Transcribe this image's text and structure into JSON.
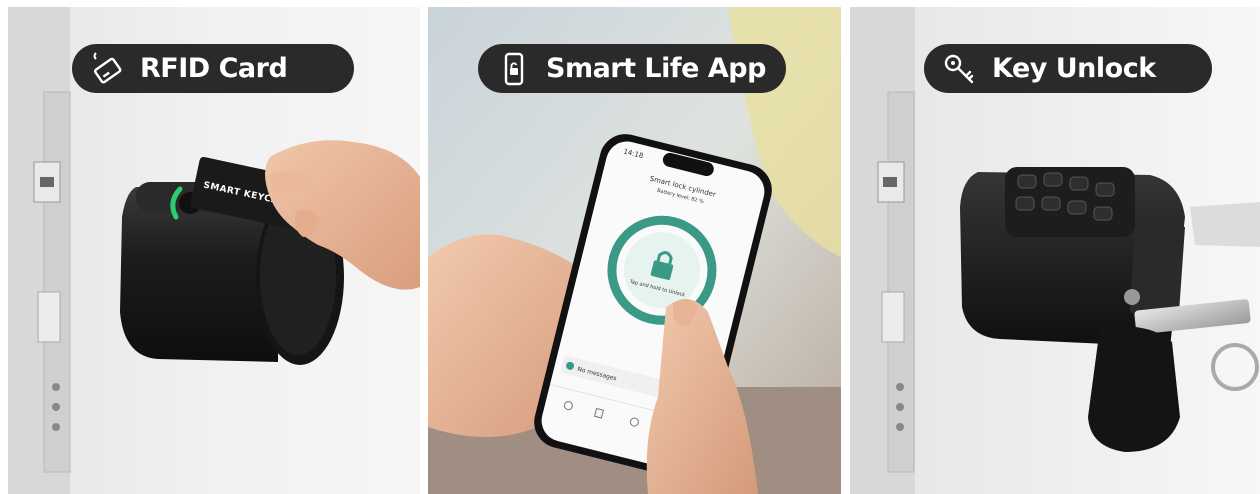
{
  "panels": [
    {
      "label": "RFID Card",
      "icon": "rfid-card-icon",
      "card_text": "SMART KEYCARD"
    },
    {
      "label": "Smart Life App",
      "icon": "phone-lock-icon",
      "phone": {
        "time": "14:18",
        "title": "Smart lock cylinder",
        "subtitle": "Battery level: 82 %",
        "unlock_hint": "Tap and hold to Unlock",
        "messages": "No messages"
      }
    },
    {
      "label": "Key Unlock",
      "icon": "key-icon"
    }
  ],
  "colors": {
    "pill_bg": "#2a2a2a",
    "pill_text": "#ffffff",
    "app_accent": "#3a9a87",
    "rfid_led": "#2ecc71"
  }
}
